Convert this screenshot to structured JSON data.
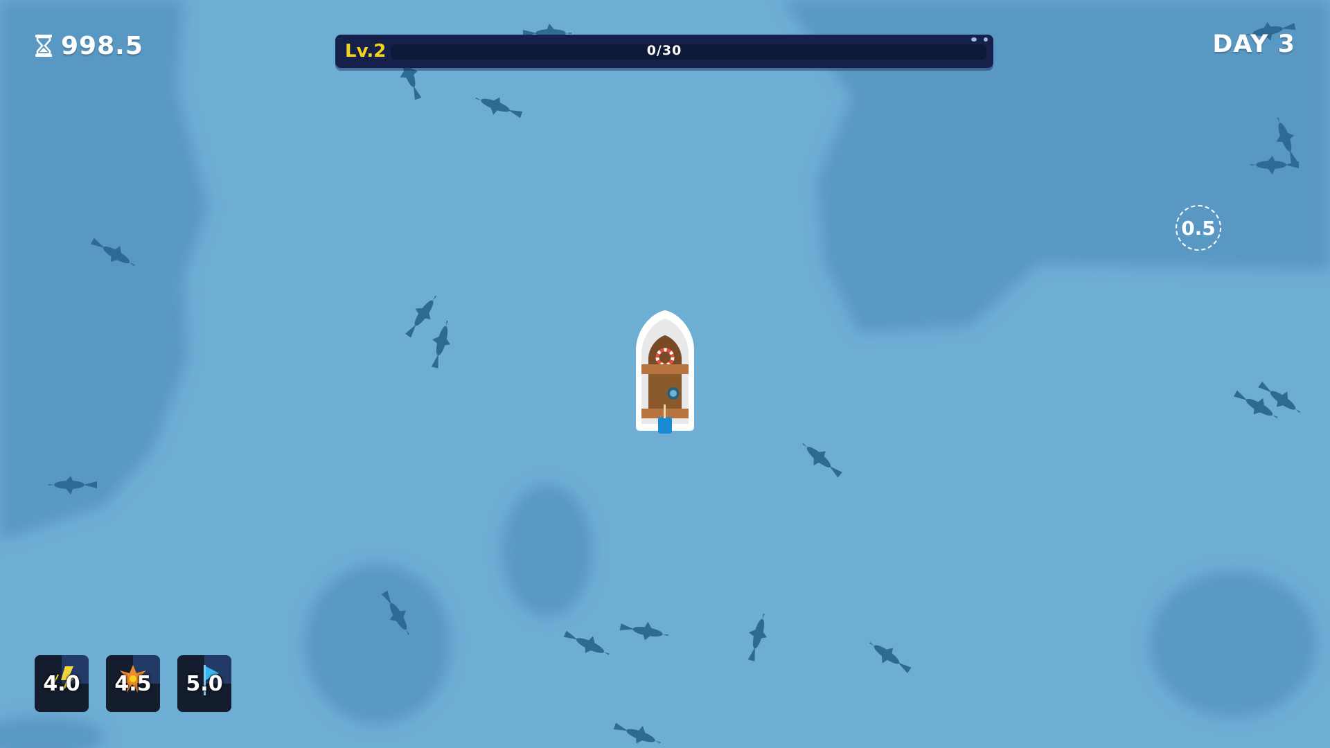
{
  "hud": {
    "timer": {
      "icon": "hourglass-icon",
      "value": "998.5"
    },
    "day_label": "DAY 3",
    "level": {
      "label": "Lv.2",
      "progress_text": "0/30",
      "progress": 0
    }
  },
  "cooldown_indicator": "0.5",
  "skills": [
    {
      "icon": "lightning-skill-icon",
      "value": "4.0"
    },
    {
      "icon": "explosion-skill-icon",
      "value": "4.5"
    },
    {
      "icon": "flag-skill-icon",
      "value": "5.0"
    }
  ],
  "colors": {
    "water": "#6eadd4",
    "deep_water": "#5a98c4",
    "fish": "#2f6a92",
    "bar_bg": "#15214a",
    "level_text": "#f5d21c"
  }
}
